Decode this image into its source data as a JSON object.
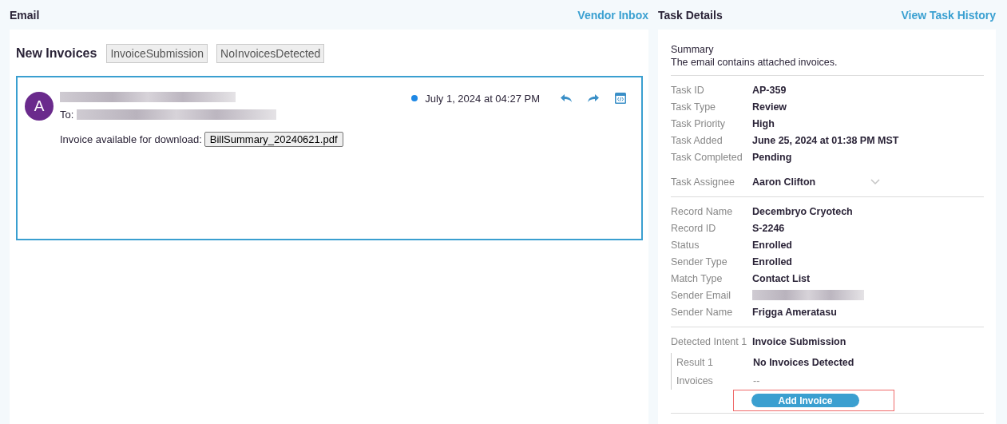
{
  "email_panel": {
    "title": "Email",
    "link": "Vendor Inbox",
    "heading": "New Invoices",
    "tags": [
      "InvoiceSubmission",
      "NoInvoicesDetected"
    ],
    "message": {
      "avatar": "A",
      "to_label": "To:",
      "unread": true,
      "date": "July 1, 2024 at 04:27 PM",
      "body": "Invoice available for download:",
      "attachment": "BillSummary_20240621.pdf"
    }
  },
  "task_panel": {
    "title": "Task Details",
    "link": "View Task History",
    "summary_label": "Summary",
    "summary": "The email contains attached invoices.",
    "task_fields": [
      {
        "label": "Task ID",
        "value": "AP-359"
      },
      {
        "label": "Task Type",
        "value": "Review"
      },
      {
        "label": "Task Priority",
        "value": "High"
      },
      {
        "label": "Task Added",
        "value": "June 25, 2024 at 01:38 PM MST"
      },
      {
        "label": "Task Completed",
        "value": "Pending"
      }
    ],
    "assignee": {
      "label": "Task Assignee",
      "value": "Aaron Clifton"
    },
    "record_fields": [
      {
        "label": "Record Name",
        "kind": "text",
        "value": "Decembryo Cryotech"
      },
      {
        "label": "Record ID",
        "kind": "text",
        "value": "S-2246"
      },
      {
        "label": "Status",
        "kind": "text",
        "value": "Enrolled"
      },
      {
        "label": "Sender Type",
        "kind": "text",
        "value": "Enrolled"
      },
      {
        "label": "Match Type",
        "kind": "text",
        "value": "Contact List"
      },
      {
        "label": "Sender Email",
        "kind": "redacted"
      },
      {
        "label": "Sender Name",
        "kind": "text",
        "value": "Frigga Ameratasu"
      }
    ],
    "intent": {
      "label": "Detected Intent 1",
      "value": "Invoice Submission",
      "results": [
        {
          "label": "Result 1",
          "kind": "text",
          "value": "No Invoices Detected"
        },
        {
          "label": "Invoices",
          "kind": "muted",
          "value": "--"
        }
      ]
    },
    "action": {
      "label": "Add Invoice",
      "highlighted": true
    }
  }
}
